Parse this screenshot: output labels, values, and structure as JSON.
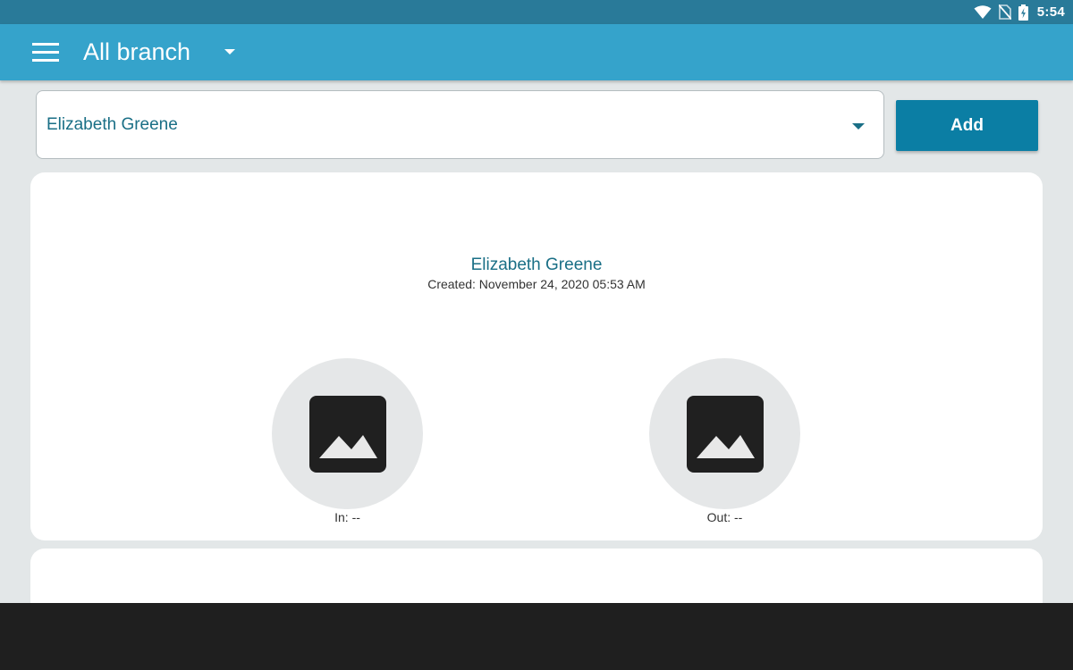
{
  "status_bar": {
    "time": "5:54",
    "icons": [
      "wifi-icon",
      "no-sim-icon",
      "battery-charging-icon"
    ]
  },
  "app_bar": {
    "title": "All branch",
    "icons": [
      "menu-icon",
      "chevron-down-icon"
    ]
  },
  "employee_select": {
    "selected_value": "Elizabeth Greene"
  },
  "add_button": {
    "label": "Add"
  },
  "entry": {
    "name": "Elizabeth Greene",
    "created": "Created: November 24, 2020 05:53 AM",
    "in_label": "In: --",
    "out_label": "Out: --",
    "photo_icon": "image-placeholder-icon"
  },
  "colors": {
    "status_bar": "#297a99",
    "app_bar": "#35a3cb",
    "accent_text": "#1a6f86",
    "button": "#0b7ea4",
    "background": "#e3e7e8"
  }
}
